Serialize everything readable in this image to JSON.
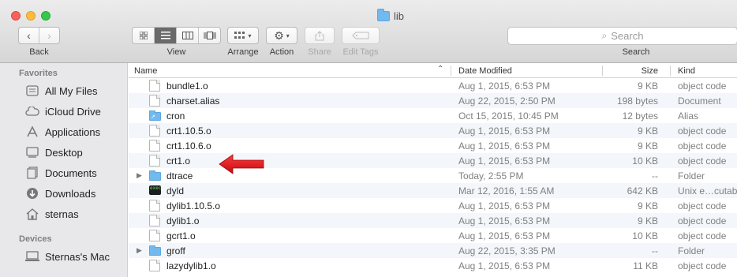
{
  "window": {
    "title": "lib"
  },
  "toolbar": {
    "back_label": "Back",
    "view_label": "View",
    "arrange_label": "Arrange",
    "action_label": "Action",
    "share_label": "Share",
    "edit_tags_label": "Edit Tags",
    "search_label": "Search",
    "search_placeholder": "Search"
  },
  "sidebar": {
    "favorites_header": "Favorites",
    "favorites": [
      {
        "label": "All My Files",
        "icon": "all-files-icon"
      },
      {
        "label": "iCloud Drive",
        "icon": "cloud-icon"
      },
      {
        "label": "Applications",
        "icon": "applications-icon"
      },
      {
        "label": "Desktop",
        "icon": "desktop-icon"
      },
      {
        "label": "Documents",
        "icon": "documents-icon"
      },
      {
        "label": "Downloads",
        "icon": "downloads-icon"
      },
      {
        "label": "sternas",
        "icon": "home-icon"
      }
    ],
    "devices_header": "Devices",
    "devices": [
      {
        "label": "Sternas's Mac",
        "icon": "computer-icon"
      }
    ]
  },
  "columns": {
    "name": "Name",
    "date": "Date Modified",
    "size": "Size",
    "kind": "Kind"
  },
  "files": [
    {
      "name": "bundle1.o",
      "date": "Aug 1, 2015, 6:53 PM",
      "size": "9 KB",
      "kind": "object code",
      "type": "doc"
    },
    {
      "name": "charset.alias",
      "date": "Aug 22, 2015, 2:50 PM",
      "size": "198 bytes",
      "kind": "Document",
      "type": "doc"
    },
    {
      "name": "cron",
      "date": "Oct 15, 2015, 10:45 PM",
      "size": "12 bytes",
      "kind": "Alias",
      "type": "alias"
    },
    {
      "name": "crt1.10.5.o",
      "date": "Aug 1, 2015, 6:53 PM",
      "size": "9 KB",
      "kind": "object code",
      "type": "doc"
    },
    {
      "name": "crt1.10.6.o",
      "date": "Aug 1, 2015, 6:53 PM",
      "size": "9 KB",
      "kind": "object code",
      "type": "doc"
    },
    {
      "name": "crt1.o",
      "date": "Aug 1, 2015, 6:53 PM",
      "size": "10 KB",
      "kind": "object code",
      "type": "doc"
    },
    {
      "name": "dtrace",
      "date": "Today, 2:55 PM",
      "size": "--",
      "kind": "Folder",
      "type": "folder"
    },
    {
      "name": "dyld",
      "date": "Mar 12, 2016, 1:55 AM",
      "size": "642 KB",
      "kind": "Unix e…cutable",
      "type": "exec"
    },
    {
      "name": "dylib1.10.5.o",
      "date": "Aug 1, 2015, 6:53 PM",
      "size": "9 KB",
      "kind": "object code",
      "type": "doc"
    },
    {
      "name": "dylib1.o",
      "date": "Aug 1, 2015, 6:53 PM",
      "size": "9 KB",
      "kind": "object code",
      "type": "doc"
    },
    {
      "name": "gcrt1.o",
      "date": "Aug 1, 2015, 6:53 PM",
      "size": "10 KB",
      "kind": "object code",
      "type": "doc"
    },
    {
      "name": "groff",
      "date": "Aug 22, 2015, 3:35 PM",
      "size": "--",
      "kind": "Folder",
      "type": "folder"
    },
    {
      "name": "lazydylib1.o",
      "date": "Aug 1, 2015, 6:53 PM",
      "size": "11 KB",
      "kind": "object code",
      "type": "doc"
    }
  ],
  "colors": {
    "accent_arrow": "#e8141b",
    "folder": "#72b9ee"
  }
}
